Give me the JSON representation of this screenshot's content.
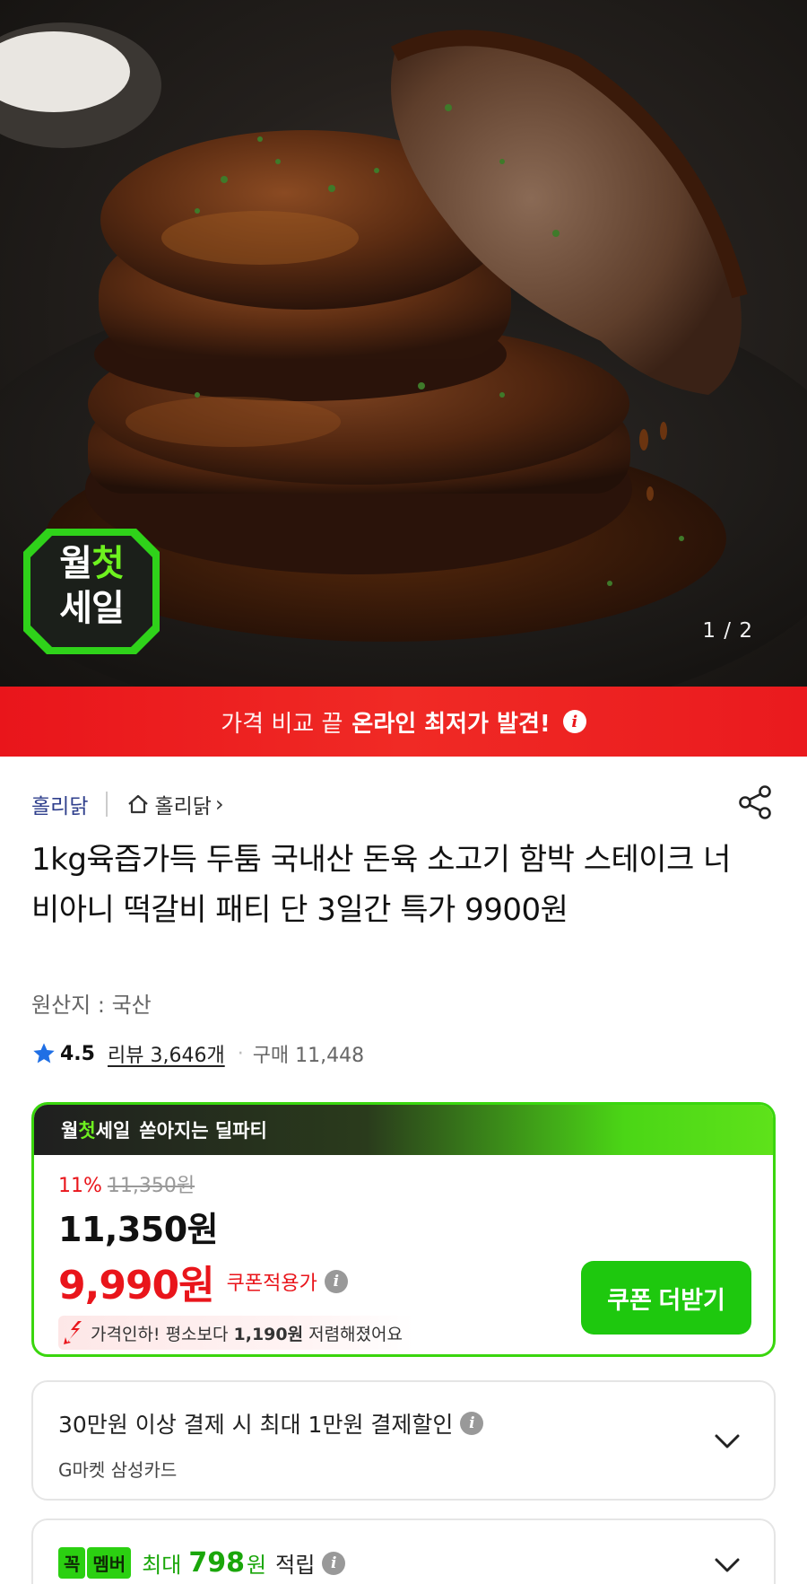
{
  "hero": {
    "badge_line1_a": "월",
    "badge_line1_b": "첫",
    "badge_line2": "세일",
    "counter": "1 / 2"
  },
  "banner": {
    "normal_text": "가격 비교 끝",
    "bold_text": "온라인 최저가 발견!",
    "info_glyph": "i"
  },
  "seller": {
    "name": "홀리닭",
    "store_link": "홀리닭",
    "store_chevron": "›"
  },
  "product": {
    "title": "1kg육즙가득 두툼 국내산 돈육 소고기 함박 스테이크 너비아니 떡갈비 패티 단 3일간 특가 9900원",
    "origin": "원산지 : 국산",
    "rating": "4.5",
    "review": "리뷰 3,646개",
    "separator": "·",
    "purchase": "구매 11,448"
  },
  "deal": {
    "header_w": "월",
    "header_c": "첫",
    "header_s": "세일",
    "header_rest": "쏟아지는 딜파티",
    "discount_pct": "11%",
    "original_price": "11,350원",
    "current_price": "11,350원",
    "coupon_price": "9,990원",
    "coupon_label": "쿠폰적용가",
    "drop_prefix": "가격인하! 평소보다",
    "drop_amount": "1,190원",
    "drop_suffix": "저렴해졌어요",
    "coupon_button": "쿠폰 더받기",
    "info_glyph": "i"
  },
  "card_discount": {
    "title": "30만원 이상 결제 시 최대 1만원 결제할인",
    "subtitle": "G마켓 삼성카드",
    "info_glyph": "i"
  },
  "membership": {
    "badge_a": "꼭",
    "badge_b": "멤버",
    "max": "최대",
    "points": "798",
    "won": "원",
    "accrue": "적립",
    "info_glyph": "i"
  },
  "colors": {
    "accent_red": "#e9151b",
    "accent_green": "#1ec80e",
    "seller_blue": "#2f3f8c",
    "star_blue": "#1f6fe5"
  }
}
